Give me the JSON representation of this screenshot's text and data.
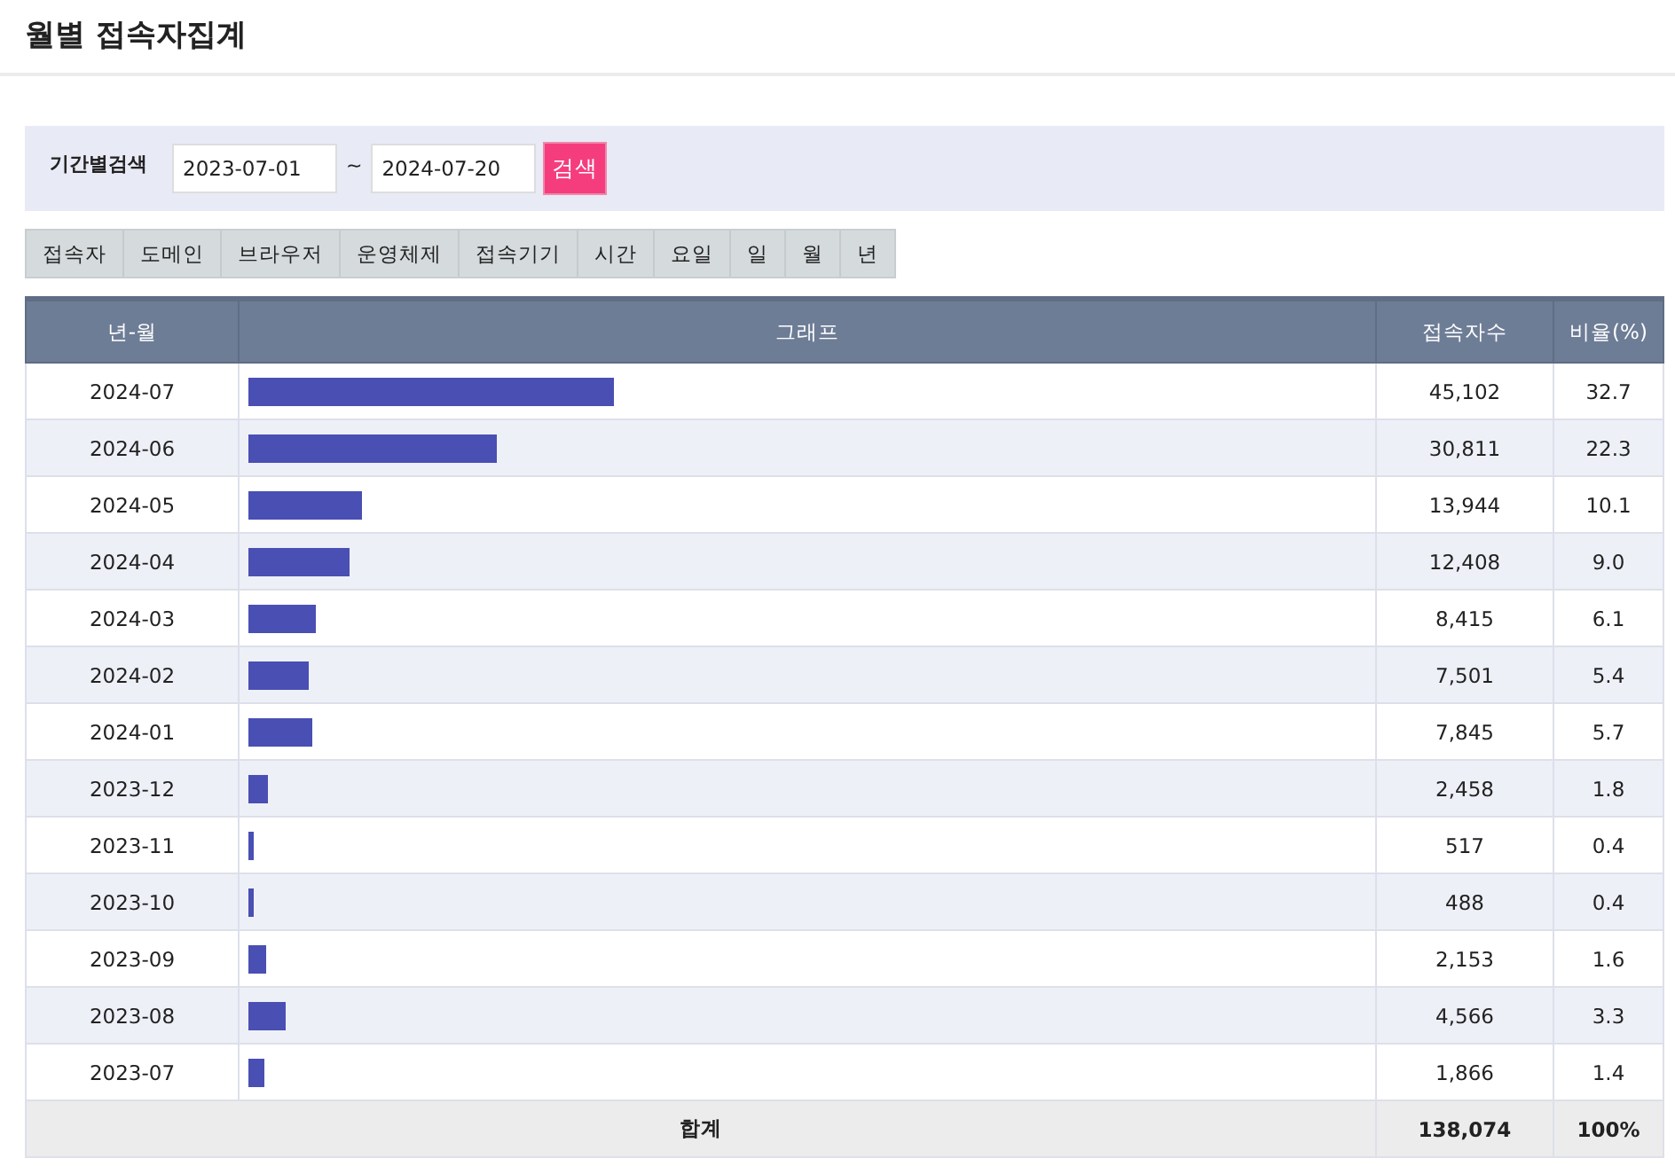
{
  "page_title": "월별 접속자집계",
  "search": {
    "label": "기간별검색",
    "start_date": "2023-07-01",
    "separator": "~",
    "end_date": "2024-07-20",
    "button": "검색"
  },
  "tabs": [
    {
      "label": "접속자",
      "selected": false
    },
    {
      "label": "도메인",
      "selected": false
    },
    {
      "label": "브라우저",
      "selected": false
    },
    {
      "label": "운영체제",
      "selected": false
    },
    {
      "label": "접속기기",
      "selected": false
    },
    {
      "label": "시간",
      "selected": false
    },
    {
      "label": "요일",
      "selected": false
    },
    {
      "label": "일",
      "selected": false
    },
    {
      "label": "월",
      "selected": false
    },
    {
      "label": "년",
      "selected": false
    }
  ],
  "table": {
    "columns": [
      "년-월",
      "그래프",
      "접속자수",
      "비율(%)"
    ],
    "rows": [
      {
        "month": "2024-07",
        "level": 0.327,
        "count": "45,102",
        "ratio": "32.7"
      },
      {
        "month": "2024-06",
        "level": 0.223,
        "count": "30,811",
        "ratio": "22.3"
      },
      {
        "month": "2024-05",
        "level": 0.101,
        "count": "13,944",
        "ratio": "10.1"
      },
      {
        "month": "2024-04",
        "level": 0.09,
        "count": "12,408",
        "ratio": "9.0"
      },
      {
        "month": "2024-03",
        "level": 0.061,
        "count": "8,415",
        "ratio": "6.1"
      },
      {
        "month": "2024-02",
        "level": 0.054,
        "count": "7,501",
        "ratio": "5.4"
      },
      {
        "month": "2024-01",
        "level": 0.057,
        "count": "7,845",
        "ratio": "5.7"
      },
      {
        "month": "2023-12",
        "level": 0.018,
        "count": "2,458",
        "ratio": "1.8"
      },
      {
        "month": "2023-11",
        "level": 0.004,
        "count": "517",
        "ratio": "0.4"
      },
      {
        "month": "2023-10",
        "level": 0.004,
        "count": "488",
        "ratio": "0.4"
      },
      {
        "month": "2023-09",
        "level": 0.016,
        "count": "2,153",
        "ratio": "1.6"
      },
      {
        "month": "2023-08",
        "level": 0.033,
        "count": "4,566",
        "ratio": "3.3"
      },
      {
        "month": "2023-07",
        "level": 0.014,
        "count": "1,866",
        "ratio": "1.4"
      }
    ],
    "total": {
      "label": "합계",
      "count": "138,074",
      "ratio": "100%"
    }
  }
}
